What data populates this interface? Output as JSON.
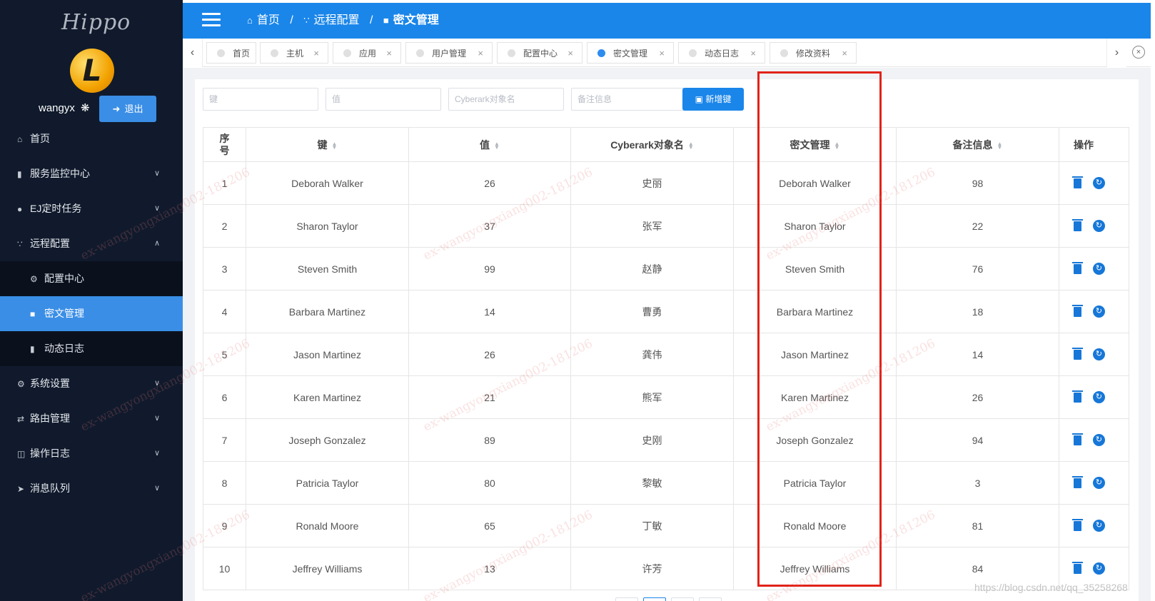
{
  "sidebar": {
    "logo": "Hippo",
    "avatar_letter": "L",
    "username": "wangyx",
    "logout_label": "退出",
    "menu": {
      "home": "首页",
      "service_monitor": "服务监控中心",
      "ej_task": "EJ定时任务",
      "remote_config": "远程配置",
      "config_center": "配置中心",
      "secret_manage": "密文管理",
      "dynamic_log": "动态日志",
      "system_settings": "系统设置",
      "route_manage": "路由管理",
      "operation_log": "操作日志",
      "message_queue": "消息队列"
    }
  },
  "header": {
    "breadcrumb": [
      "首页",
      "远程配置",
      "密文管理"
    ],
    "separator": "/"
  },
  "tabs": [
    {
      "label": "首页"
    },
    {
      "label": "主机"
    },
    {
      "label": "应用"
    },
    {
      "label": "用户管理"
    },
    {
      "label": "配置中心"
    },
    {
      "label": "密文管理"
    },
    {
      "label": "动态日志"
    },
    {
      "label": "修改资料"
    }
  ],
  "filters": {
    "key_placeholder": "键",
    "value_placeholder": "值",
    "cyberark_placeholder": "Cyberark对象名",
    "remark_placeholder": "备注信息",
    "add_button": "新增键"
  },
  "table": {
    "headers": {
      "seq": "序号",
      "key": "键",
      "value": "值",
      "cyberark": "Cyberark对象名",
      "secret": "密文管理",
      "remark": "备注信息",
      "ops": "操作"
    },
    "rows": [
      {
        "seq": "1",
        "key": "Deborah Walker",
        "value": "26",
        "cyberark": "史丽",
        "secret": "Deborah Walker",
        "remark": "98"
      },
      {
        "seq": "2",
        "key": "Sharon Taylor",
        "value": "37",
        "cyberark": "张军",
        "secret": "Sharon Taylor",
        "remark": "22"
      },
      {
        "seq": "3",
        "key": "Steven Smith",
        "value": "99",
        "cyberark": "赵静",
        "secret": "Steven Smith",
        "remark": "76"
      },
      {
        "seq": "4",
        "key": "Barbara Martinez",
        "value": "14",
        "cyberark": "曹勇",
        "secret": "Barbara Martinez",
        "remark": "18"
      },
      {
        "seq": "5",
        "key": "Jason Martinez",
        "value": "26",
        "cyberark": "龚伟",
        "secret": "Jason Martinez",
        "remark": "14"
      },
      {
        "seq": "6",
        "key": "Karen Martinez",
        "value": "21",
        "cyberark": "熊军",
        "secret": "Karen Martinez",
        "remark": "26"
      },
      {
        "seq": "7",
        "key": "Joseph Gonzalez",
        "value": "89",
        "cyberark": "史刚",
        "secret": "Joseph Gonzalez",
        "remark": "94"
      },
      {
        "seq": "8",
        "key": "Patricia Taylor",
        "value": "80",
        "cyberark": "黎敏",
        "secret": "Patricia Taylor",
        "remark": "3"
      },
      {
        "seq": "9",
        "key": "Ronald Moore",
        "value": "65",
        "cyberark": "丁敏",
        "secret": "Ronald Moore",
        "remark": "81"
      },
      {
        "seq": "10",
        "key": "Jeffrey Williams",
        "value": "13",
        "cyberark": "许芳",
        "secret": "Jeffrey Williams",
        "remark": "84"
      }
    ]
  },
  "watermark": "ex-wangyongxiang002-181206",
  "csdn_watermark": "https://blog.csdn.net/qq_35258268",
  "colors": {
    "sidebar_bg": "#101a2c",
    "header_bg": "#1a86ea",
    "active_menu": "#3a8ee6",
    "highlight_box": "#e1231a"
  }
}
